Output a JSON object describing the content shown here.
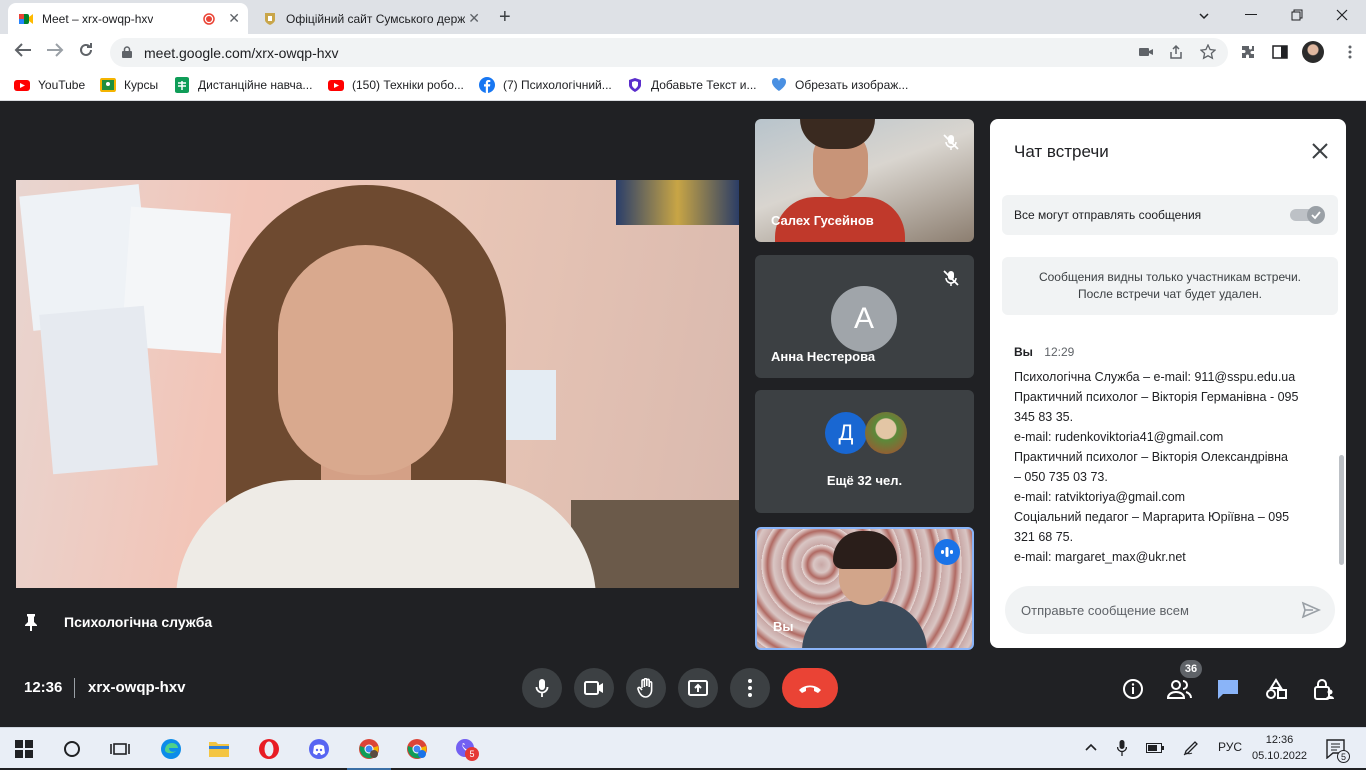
{
  "browser": {
    "tabs": [
      {
        "title": "Meet – xrx-owqp-hxv"
      },
      {
        "title": "Офіційний сайт Сумського держ"
      }
    ],
    "url": "meet.google.com/xrx-owqp-hxv",
    "bookmarks": [
      {
        "label": "YouTube",
        "color": "#ff0000"
      },
      {
        "label": "Курсы",
        "color": "#e8b400"
      },
      {
        "label": "Дистанційне навча...",
        "color": "#0f9d58"
      },
      {
        "label": "(150) Техніки робо...",
        "color": "#ff0000"
      },
      {
        "label": "(7) Психологічний...",
        "color": "#1877f2"
      },
      {
        "label": "Добавьте Текст и...",
        "color": "#5b2ecc"
      },
      {
        "label": "Обрезать изображ...",
        "color": "#4a90e2"
      }
    ]
  },
  "meeting": {
    "main_presenter": "Психологічна служба",
    "participants": [
      {
        "name": "Салех Гусейнов"
      },
      {
        "name": "Анна Нестерова",
        "initial": "А"
      },
      {
        "name": "Вы"
      }
    ],
    "others": {
      "initial": "Д",
      "label": "Ещё 32 чел."
    },
    "time": "12:36",
    "code": "xrx-owqp-hxv",
    "people_count": "36"
  },
  "chat": {
    "title": "Чат встречи",
    "toggle_label": "Все могут отправлять сообщения",
    "info_line1": "Сообщения видны только участникам встречи.",
    "info_line2": "После встречи чат будет удален.",
    "sender": "Вы",
    "sent_time": "12:29",
    "lines": [
      "Психологічна Служба – e-mail: 911@sspu.edu.ua",
      "Практичний психолог – Вікторія Германівна - 095",
      "345 83 35.",
      "e-mail: rudenkoviktoria41@gmail.com",
      "Практичний психолог – Вікторія Олександрівна",
      "– 050 735 03 73.",
      "e-mail: ratviktoriya@gmail.com",
      "Соціальний педагог – Маргарита Юріївна – 095",
      "321 68 75.",
      "e-mail: margaret_max@ukr.net"
    ],
    "input_placeholder": "Отправьте сообщение всем"
  },
  "taskbar": {
    "lang": "РУС",
    "clock_time": "12:36",
    "clock_date": "05.10.2022",
    "viber_badge": "5",
    "notif_count": "5"
  },
  "colors": {
    "meet_bg": "#202124",
    "end_call": "#ea4335",
    "accent": "#1a73e8"
  }
}
